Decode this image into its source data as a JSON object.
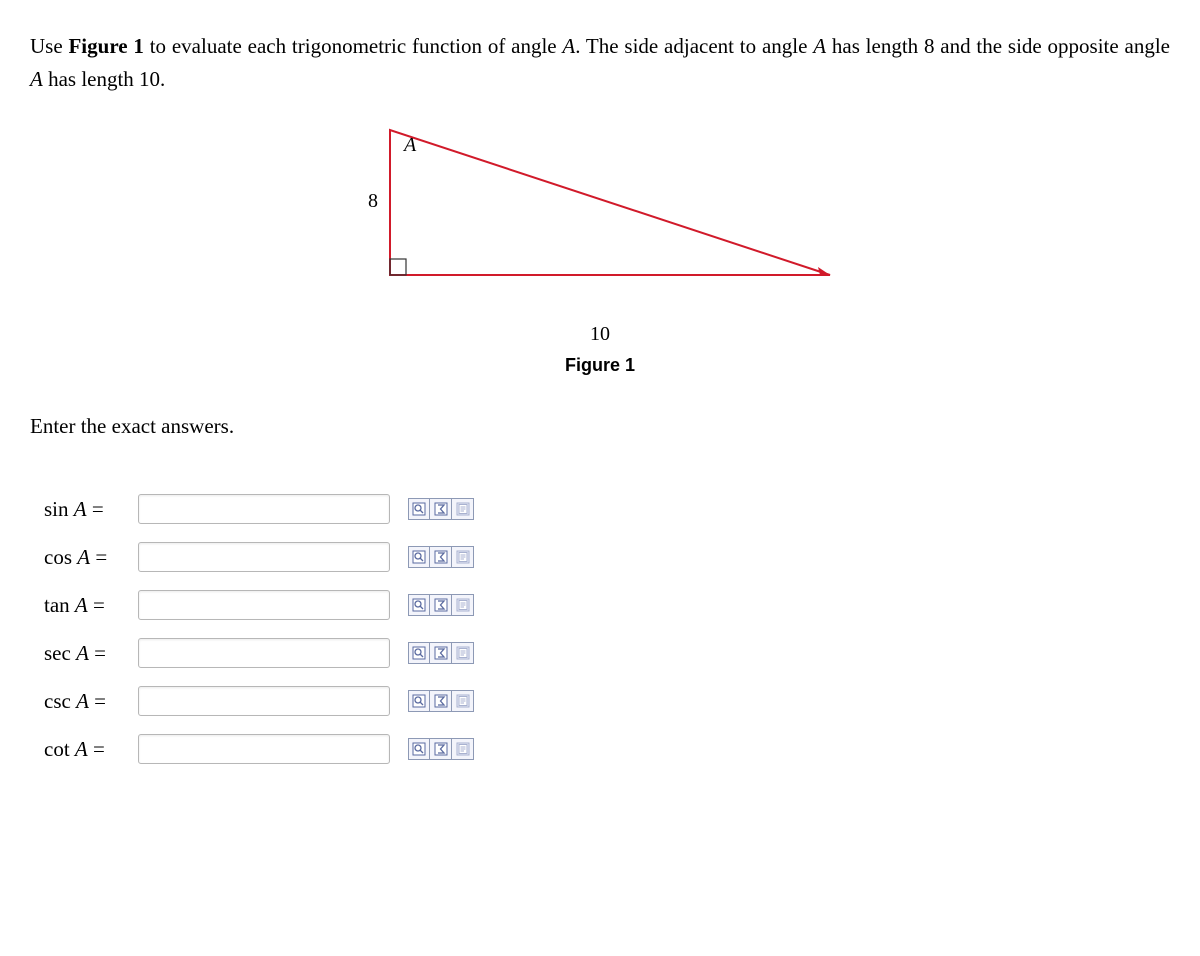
{
  "question": {
    "prefix": "Use ",
    "figref": "Figure 1",
    "mid1": " to evaluate each trigonometric function of angle ",
    "angle": "A",
    "mid2": ". The side adjacent to angle ",
    "mid3": " has length 8 and the side opposite angle ",
    "mid4": " has length 10."
  },
  "figure": {
    "angle_label": "A",
    "adjacent_label": "8",
    "opposite_label": "10",
    "caption": "Figure 1"
  },
  "subprompt": "Enter the exact answers.",
  "rows": [
    {
      "fn": "sin",
      "var": "A",
      "eq": " =",
      "value": ""
    },
    {
      "fn": "cos",
      "var": "A",
      "eq": " =",
      "value": ""
    },
    {
      "fn": "tan",
      "var": "A",
      "eq": " =",
      "value": ""
    },
    {
      "fn": "sec",
      "var": "A",
      "eq": " =",
      "value": ""
    },
    {
      "fn": "csc",
      "var": "A",
      "eq": " =",
      "value": ""
    },
    {
      "fn": "cot",
      "var": "A",
      "eq": " =",
      "value": ""
    }
  ],
  "toolbar": {
    "preview_title": "Preview",
    "sigma_title": "Symbols",
    "help_title": "Help"
  }
}
